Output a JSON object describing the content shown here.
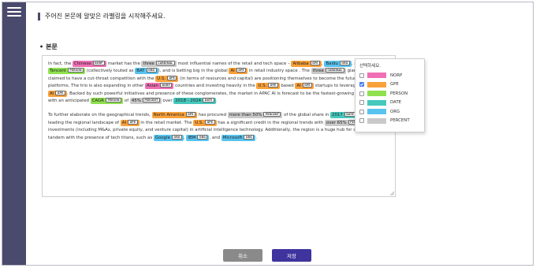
{
  "instruction": "주어진 본문에 알맞은 라벨링을 시작해주세요.",
  "section_label": "본문",
  "paragraphs": [
    [
      {
        "t": "In fact, the "
      },
      {
        "t": "Chinese",
        "l": "NORP"
      },
      {
        "t": " market has the "
      },
      {
        "t": "three",
        "l": "CARDINAL"
      },
      {
        "t": " most influential names of the retail and tech space – "
      },
      {
        "t": "Alibaba",
        "l": "GPE"
      },
      {
        "t": ", "
      },
      {
        "t": "Baidu",
        "l": "ORG"
      },
      {
        "t": ", and "
      },
      {
        "t": "Tencent",
        "l": "PERSON"
      },
      {
        "t": " (collectively touted as "
      },
      {
        "t": "BAT",
        "l": "ORG"
      },
      {
        "t": "), and is betting big in the global "
      },
      {
        "t": "AI",
        "l": "GPE"
      },
      {
        "t": " in retail industry space . The "
      },
      {
        "t": "three",
        "l": "CARDINAL"
      },
      {
        "t": " giants which are claimed to have a cut-throat competition with the "
      },
      {
        "t": "U.S.",
        "l": "GPE"
      },
      {
        "t": " (in terms of resources and capital) are positioning themselves to become the future "
      },
      {
        "t": "AI",
        "l": "PERSON"
      },
      {
        "t": " platforms. The trio is also expanding in other "
      },
      {
        "t": "Asian",
        "l": "NORP"
      },
      {
        "t": " countries and investing heavily in the "
      },
      {
        "t": "U.S.",
        "l": "GPE"
      },
      {
        "t": " based "
      },
      {
        "t": "AI",
        "l": "GPE"
      },
      {
        "t": " startups to leverage the power of "
      },
      {
        "t": "AI",
        "l": "GPE"
      },
      {
        "t": ". Backed by such powerful initiatives and presence of these conglomerates, the market in APAC AI is forecast to be the fastest-growing "
      },
      {
        "t": "one",
        "l": "CARDINAL"
      },
      {
        "t": ", with an anticipated "
      },
      {
        "t": "CAGR",
        "l": "PERSON"
      },
      {
        "t": " of "
      },
      {
        "t": "45%",
        "l": "PERCENT"
      },
      {
        "t": " over "
      },
      {
        "t": "2018 - 2024",
        "l": "DATE"
      },
      {
        "t": "."
      }
    ],
    [
      {
        "t": "To further elaborate on the geographical trends, "
      },
      {
        "t": "North America",
        "l": "GPE"
      },
      {
        "t": " has procured "
      },
      {
        "t": "more than 50%",
        "l": "PERCENT"
      },
      {
        "t": " of the global share in "
      },
      {
        "t": "2017",
        "l": "DATE"
      },
      {
        "t": " and has been leading the regional landscape of "
      },
      {
        "t": "AI",
        "l": "GPE"
      },
      {
        "t": " in the retail market. The "
      },
      {
        "t": "U.S.",
        "l": "GPE"
      },
      {
        "t": " has a significant credit in the regional trends with "
      },
      {
        "t": "over 65%",
        "l": "PERCENT"
      },
      {
        "t": " of investments (including M&As, private equity, and venture capital) in artificial intelligence technology. Additionally, the region is a huge hub for startups in tandem with the presence of tech titans, such as "
      },
      {
        "t": "Google",
        "l": "ORG"
      },
      {
        "t": ", "
      },
      {
        "t": "IBM",
        "l": "ORG"
      },
      {
        "t": ", and "
      },
      {
        "t": "Microsoft",
        "l": "ORG"
      },
      {
        "t": "."
      }
    ]
  ],
  "tag_text": {
    "NORP": "NORP",
    "GPE": "GPE",
    "PERSON": "PERSON",
    "DATE": "DATE",
    "ORG": "ORG",
    "PERCENT": "PERCENT",
    "CARDINAL": "CARDINAL"
  },
  "label_panel": {
    "title": "선택하세요.",
    "items": [
      {
        "name": "NORP",
        "color": "#f06fb4",
        "checked": false
      },
      {
        "name": "GPE",
        "color": "#f9a13a",
        "checked": true
      },
      {
        "name": "PERSON",
        "color": "#8fe14f",
        "checked": false
      },
      {
        "name": "DATE",
        "color": "#46c8bd",
        "checked": false
      },
      {
        "name": "ORG",
        "color": "#58c3ef",
        "checked": false
      },
      {
        "name": "PERCENT",
        "color": "#c9c9c9",
        "checked": false
      }
    ]
  },
  "buttons": {
    "cancel": "취소",
    "save": "저장"
  },
  "colors": {
    "sidebar": "#4a4a6c",
    "save_button": "#3f349e",
    "cancel_button": "#8a8a8a"
  }
}
